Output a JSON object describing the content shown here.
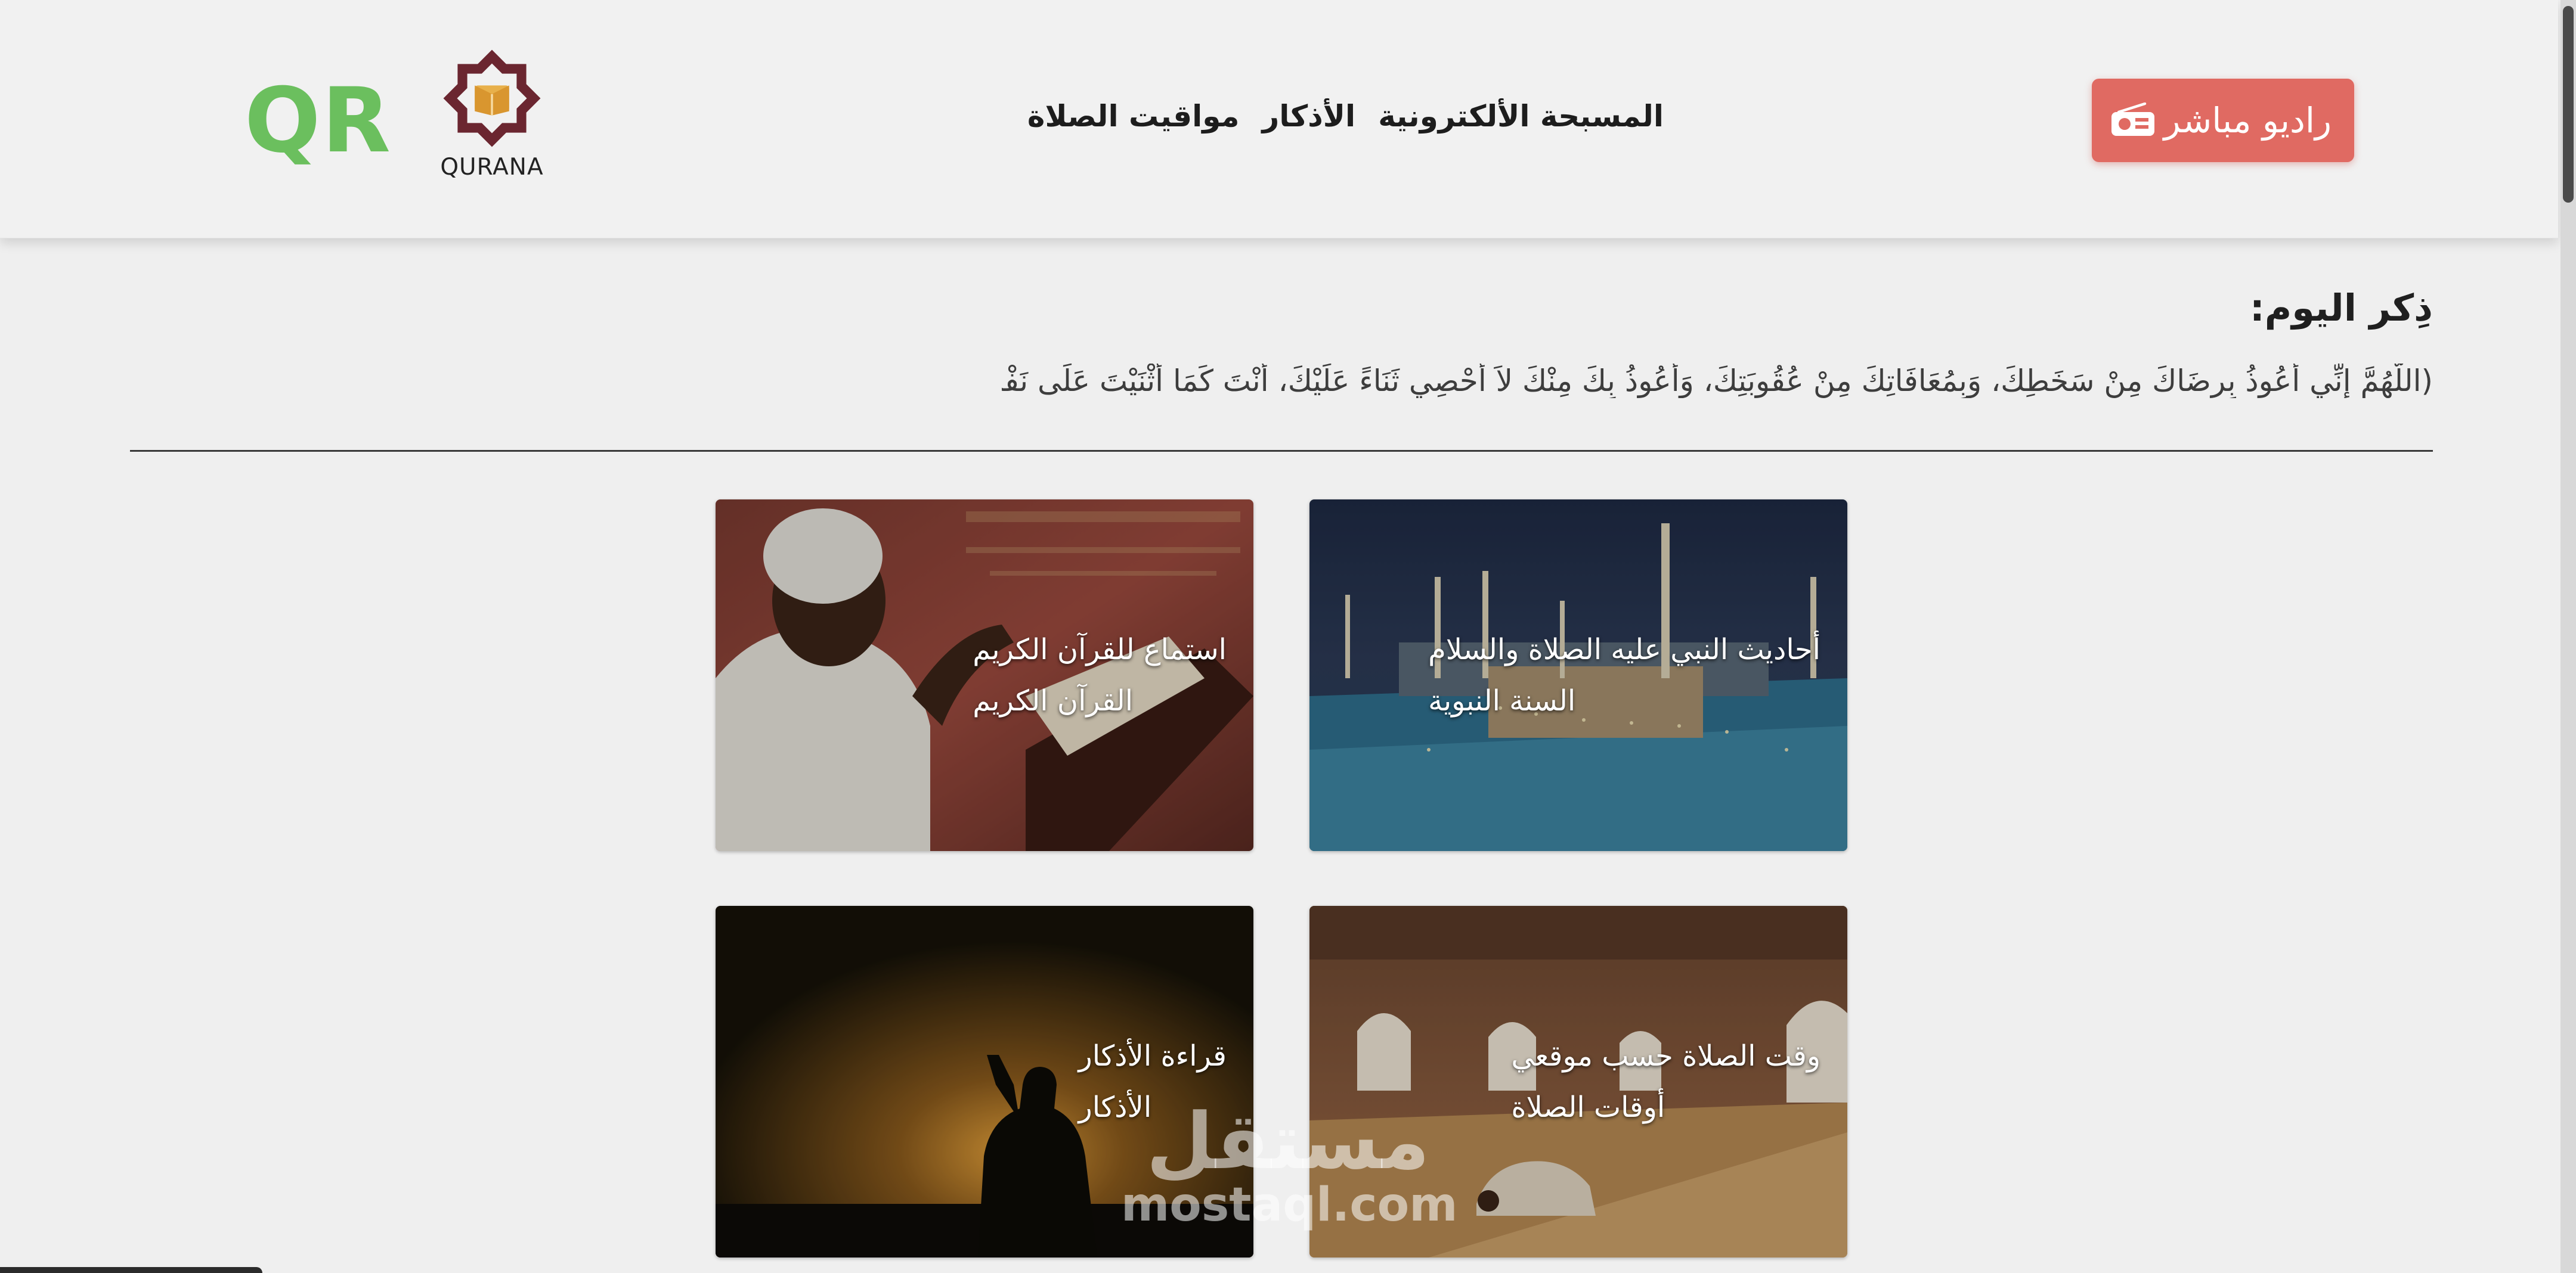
{
  "header": {
    "qr_logo": "QR",
    "brand_name": "QURANA",
    "nav": [
      "المسبحة الألكترونية",
      "الأذكار",
      "مواقيت الصلاة"
    ],
    "radio_label": "راديو مباشر"
  },
  "dhikr": {
    "title": "ذِكر اليوم:",
    "text": "(اللَّهُمَّ إِنِّي أَعُوذُ بِرِضَاكَ مِنْ سَخَطِكَ، وَبِمُعَافَاتِكَ مِنْ عُقُوبَتِكَ، وَأَعُوذُ بِكَ مِنْكَ لاَ أُحْصِي ثَنَاءً عَلَيْكَ، أَنْتَ كَمَا أَثْنَيْتَ عَلَى نَفْسِكَ)"
  },
  "cards": [
    {
      "title": "أحاديث النبي عليه الصلاة والسلام",
      "subtitle": "السنة النبوية"
    },
    {
      "title": "استماع للقرآن الكريم",
      "subtitle": "القرآن الكريم"
    },
    {
      "title": "وقت الصلاة حسب موقعي",
      "subtitle": "أوقات الصلاة"
    },
    {
      "title": "قراءة الأذكار",
      "subtitle": "الأذكار"
    }
  ],
  "watermark": {
    "arabic": "مستقل",
    "latin": "mostaql.com"
  },
  "colors": {
    "radio_button": "#e06a62",
    "qr_logo": "#6bbf5e",
    "brand_star": "#6b2630",
    "page_background": "#efefef"
  },
  "icons": [
    "radio-icon",
    "qurana-star-logo"
  ]
}
